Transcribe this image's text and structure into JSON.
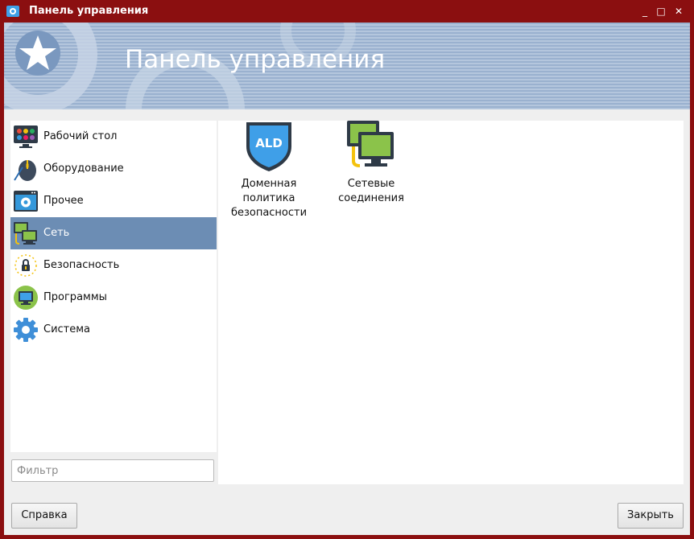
{
  "window": {
    "title": "Панель управления",
    "controls": {
      "minimize": "_",
      "maximize": "□",
      "close": "✕"
    }
  },
  "banner": {
    "heading": "Панель управления"
  },
  "sidebar": {
    "items": [
      {
        "label": "Рабочий стол",
        "icon": "desktop-icon"
      },
      {
        "label": "Оборудование",
        "icon": "hardware-mouse-icon"
      },
      {
        "label": "Прочее",
        "icon": "misc-gear-window-icon"
      },
      {
        "label": "Сеть",
        "icon": "network-icon",
        "selected": true
      },
      {
        "label": "Безопасность",
        "icon": "security-lock-icon"
      },
      {
        "label": "Программы",
        "icon": "programs-monitor-icon"
      },
      {
        "label": "Система",
        "icon": "system-gear-icon"
      }
    ]
  },
  "filter": {
    "placeholder": "Фильтр",
    "value": ""
  },
  "content": {
    "items": [
      {
        "label": "Доменная политика безопасности",
        "icon": "ald-shield-icon",
        "badge": "ALD"
      },
      {
        "label": "Сетевые соединения",
        "icon": "network-connections-icon"
      }
    ]
  },
  "buttons": {
    "help": "Справка",
    "close": "Закрыть"
  },
  "colors": {
    "titlebar": "#8b0f10",
    "selection": "#6c8db4",
    "banner": "#9ab1cf"
  }
}
